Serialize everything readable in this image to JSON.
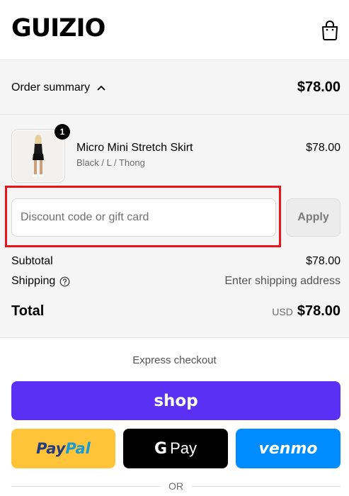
{
  "header": {
    "logo": "GUIZIO",
    "cart_icon": "shopping-bag-icon"
  },
  "summary": {
    "toggle_label": "Order summary",
    "toggle_icon": "chevron-up-icon",
    "total": "$78.00"
  },
  "item": {
    "name": "Micro Mini Stretch Skirt",
    "variant": "Black / L / Thong",
    "price": "$78.00",
    "quantity": "1"
  },
  "discount": {
    "placeholder": "Discount code or gift card",
    "value": "",
    "apply_label": "Apply"
  },
  "totals": {
    "subtotal_label": "Subtotal",
    "subtotal_value": "$78.00",
    "shipping_label": "Shipping",
    "shipping_value": "Enter shipping address",
    "total_label": "Total",
    "currency": "USD",
    "total_value": "$78.00"
  },
  "express": {
    "title": "Express checkout",
    "shop_label": "shop",
    "paypal_a": "Pay",
    "paypal_b": "Pal",
    "gpay_g": "G",
    "gpay_label": "Pay",
    "venmo_label": "venmo"
  },
  "divider": {
    "or_label": "OR"
  },
  "colors": {
    "highlight": "#e8131b",
    "shop": "#5a31f4",
    "paypal": "#ffc439",
    "gpay": "#000000",
    "venmo": "#008cff"
  }
}
